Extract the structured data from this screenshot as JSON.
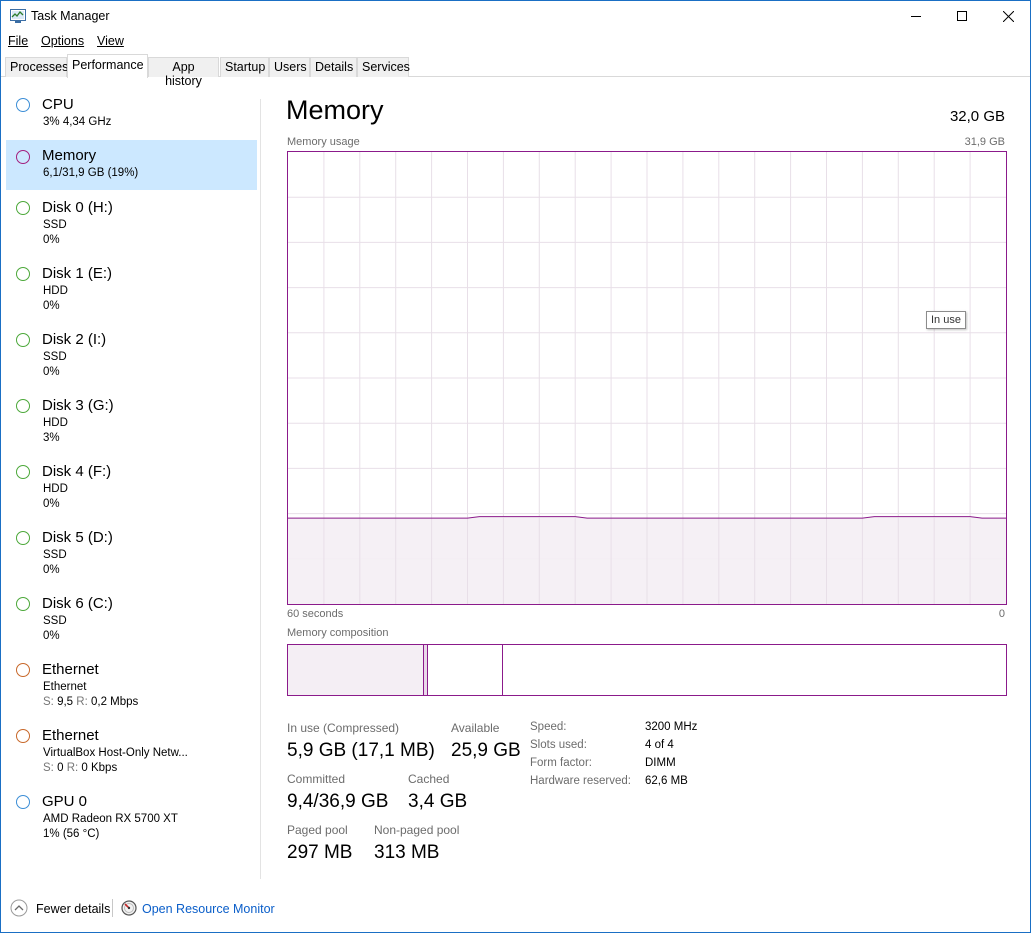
{
  "window": {
    "title": "Task Manager"
  },
  "menu": {
    "file": "File",
    "options": "Options",
    "view": "View"
  },
  "tabs": [
    {
      "label": "Processes"
    },
    {
      "label": "Performance"
    },
    {
      "label": "App history"
    },
    {
      "label": "Startup"
    },
    {
      "label": "Users"
    },
    {
      "label": "Details"
    },
    {
      "label": "Services"
    }
  ],
  "active_tab": "Performance",
  "sidebar": {
    "items": [
      {
        "title": "CPU",
        "line1": "3%  4,34 GHz",
        "color": "#3c8ed6"
      },
      {
        "title": "Memory",
        "line1": "6,1/31,9 GB (19%)",
        "color": "#a3207e",
        "selected": true
      },
      {
        "title": "Disk 0 (H:)",
        "line1": "SSD",
        "line2": "0%",
        "color": "#4ca83a"
      },
      {
        "title": "Disk 1 (E:)",
        "line1": "HDD",
        "line2": "0%",
        "color": "#4ca83a"
      },
      {
        "title": "Disk 2 (I:)",
        "line1": "SSD",
        "line2": "0%",
        "color": "#4ca83a"
      },
      {
        "title": "Disk 3 (G:)",
        "line1": "HDD",
        "line2": "3%",
        "color": "#4ca83a"
      },
      {
        "title": "Disk 4 (F:)",
        "line1": "HDD",
        "line2": "0%",
        "color": "#4ca83a"
      },
      {
        "title": "Disk 5 (D:)",
        "line1": "SSD",
        "line2": "0%",
        "color": "#4ca83a"
      },
      {
        "title": "Disk 6 (C:)",
        "line1": "SSD",
        "line2": "0%",
        "color": "#4ca83a"
      },
      {
        "title": "Ethernet",
        "line1": "Ethernet",
        "s_label": "S:",
        "s_value": "9,5",
        "r_label": "R:",
        "r_value": "0,2 Mbps",
        "color": "#c8682a"
      },
      {
        "title": "Ethernet",
        "line1": "VirtualBox Host-Only Netw...",
        "s_label": "S:",
        "s_value": "0",
        "r_label": "R:",
        "r_value": "0 Kbps",
        "color": "#c8682a"
      },
      {
        "title": "GPU 0",
        "line1": "AMD Radeon RX 5700 XT",
        "line2": "1%  (56 °C)",
        "color": "#3c8ed6"
      }
    ]
  },
  "main": {
    "title": "Memory",
    "total": "32,0 GB",
    "usage_label": "Memory usage",
    "usage_max": "31,9 GB",
    "axis_left": "60 seconds",
    "axis_right": "0",
    "tooltip": "In use",
    "composition_label": "Memory composition",
    "usage_fraction": 0.19
  },
  "composition": {
    "in_use_fraction": 0.189,
    "modified_fraction": 0.006,
    "standby_fraction": 0.105
  },
  "stats": {
    "in_use_label": "In use (Compressed)",
    "in_use_value": "5,9 GB (17,1 MB)",
    "available_label": "Available",
    "available_value": "25,9 GB",
    "committed_label": "Committed",
    "committed_value": "9,4/36,9 GB",
    "cached_label": "Cached",
    "cached_value": "3,4 GB",
    "paged_label": "Paged pool",
    "paged_value": "297 MB",
    "nonpaged_label": "Non-paged pool",
    "nonpaged_value": "313 MB"
  },
  "specs": {
    "speed_label": "Speed:",
    "speed_value": "3200 MHz",
    "slots_label": "Slots used:",
    "slots_value": "4 of 4",
    "form_label": "Form factor:",
    "form_value": "DIMM",
    "hwres_label": "Hardware reserved:",
    "hwres_value": "62,6 MB"
  },
  "footer": {
    "fewer_details": "Fewer details",
    "open_resource_monitor": "Open Resource Monitor"
  },
  "colors": {
    "memory_accent": "#8b1a8b",
    "memory_fill": "#f4eef4",
    "grid": "#e8dfe8",
    "selected_bg": "#cce8ff",
    "link": "#0a5ec9"
  },
  "icons": {
    "app": "task-manager-icon",
    "minimize": "minimize-icon",
    "maximize": "maximize-icon",
    "close": "close-icon",
    "fewer": "chevron-up-circle-icon",
    "resmon": "resource-monitor-icon"
  }
}
